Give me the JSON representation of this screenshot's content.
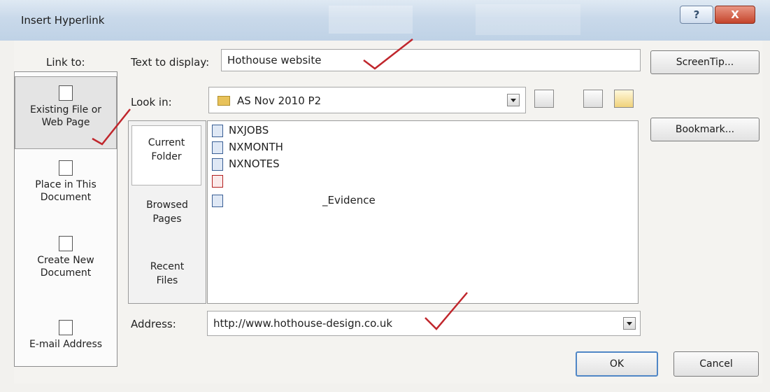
{
  "window": {
    "title": "Insert Hyperlink",
    "help_glyph": "?",
    "close_glyph": "X"
  },
  "link_to": {
    "label": "Link to:",
    "items": [
      {
        "line1": "Existing File or",
        "line2": "Web Page",
        "icon": "web-page-icon"
      },
      {
        "line1": "Place in This",
        "line2": "Document",
        "icon": "bookmark-doc-icon"
      },
      {
        "line1": "Create New",
        "line2": "Document",
        "icon": "new-doc-icon"
      },
      {
        "line1": "E-mail Address",
        "line2": "",
        "icon": "email-icon"
      }
    ]
  },
  "text_to_display": {
    "label": "Text to display:",
    "value": "Hothouse website"
  },
  "screentip_label": "ScreenTip...",
  "look_in": {
    "label": "Look in:",
    "value": "AS Nov 2010 P2"
  },
  "bookmark_label": "Bookmark...",
  "nav": {
    "items": [
      {
        "line1": "Current",
        "line2": "Folder"
      },
      {
        "line1": "Browsed",
        "line2": "Pages"
      },
      {
        "line1": "Recent",
        "line2": "Files"
      }
    ]
  },
  "files": [
    {
      "name": "NXJOBS",
      "type": "doc"
    },
    {
      "name": "NXMONTH",
      "type": "doc"
    },
    {
      "name": "NXNOTES",
      "type": "doc"
    },
    {
      "name": "",
      "type": "pdf"
    },
    {
      "name": "_Evidence",
      "type": "doc"
    }
  ],
  "address": {
    "label": "Address:",
    "value": "http://www.hothouse-design.co.uk"
  },
  "ok_label": "OK",
  "cancel_label": "Cancel",
  "colors": {
    "title_bar": "#c9d9ea",
    "close_button": "#c4442b",
    "annotation_ticks": "#c0262c"
  }
}
